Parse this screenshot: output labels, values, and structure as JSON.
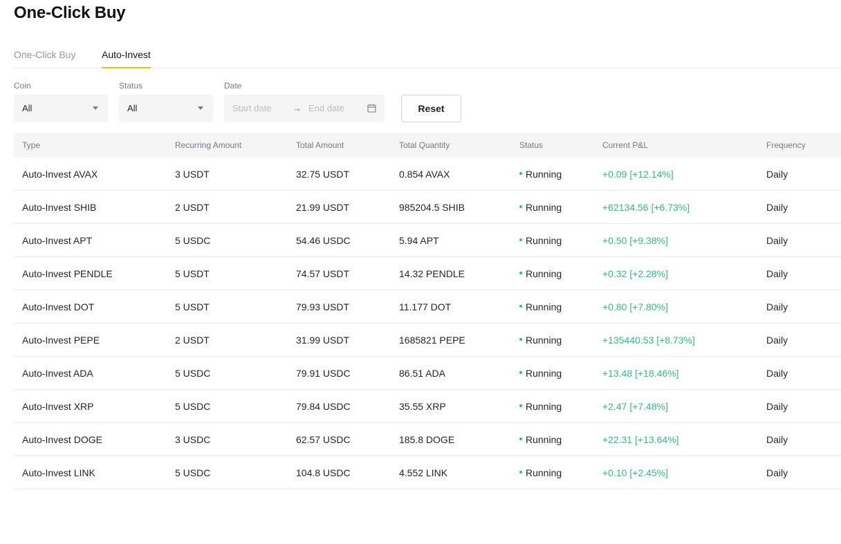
{
  "page": {
    "title": "One-Click Buy"
  },
  "tabs": [
    {
      "label": "One-Click Buy",
      "active": false
    },
    {
      "label": "Auto-Invest",
      "active": true
    }
  ],
  "filters": {
    "coin": {
      "label": "Coin",
      "value": "All"
    },
    "status": {
      "label": "Status",
      "value": "All"
    },
    "date": {
      "label": "Date",
      "start_placeholder": "Start date",
      "end_placeholder": "End date",
      "separator": "→"
    },
    "reset_label": "Reset"
  },
  "colors": {
    "accent": "#f0b90b",
    "positive": "#2ebd85"
  },
  "table": {
    "columns": [
      "Type",
      "Recurring Amount",
      "Total Amount",
      "Total Quantity",
      "Status",
      "Current P&L",
      "Frequency"
    ],
    "rows": [
      {
        "type": "Auto-Invest AVAX",
        "recurring": "3 USDT",
        "total": "32.75 USDT",
        "quantity": "0.854 AVAX",
        "status": "Running",
        "pnl": "+0.09 [+12.14%]",
        "frequency": "Daily"
      },
      {
        "type": "Auto-Invest SHIB",
        "recurring": "2 USDT",
        "total": "21.99 USDT",
        "quantity": "985204.5 SHIB",
        "status": "Running",
        "pnl": "+62134.56 [+6.73%]",
        "frequency": "Daily"
      },
      {
        "type": "Auto-Invest APT",
        "recurring": "5 USDC",
        "total": "54.46 USDC",
        "quantity": "5.94 APT",
        "status": "Running",
        "pnl": "+0.50 [+9.38%]",
        "frequency": "Daily"
      },
      {
        "type": "Auto-Invest PENDLE",
        "recurring": "5 USDT",
        "total": "74.57 USDT",
        "quantity": "14.32 PENDLE",
        "status": "Running",
        "pnl": "+0.32 [+2.28%]",
        "frequency": "Daily"
      },
      {
        "type": "Auto-Invest DOT",
        "recurring": "5 USDT",
        "total": "79.93 USDT",
        "quantity": "11.177 DOT",
        "status": "Running",
        "pnl": "+0.80 [+7.80%]",
        "frequency": "Daily"
      },
      {
        "type": "Auto-Invest PEPE",
        "recurring": "2 USDT",
        "total": "31.99 USDT",
        "quantity": "1685821 PEPE",
        "status": "Running",
        "pnl": "+135440.53 [+8.73%]",
        "frequency": "Daily"
      },
      {
        "type": "Auto-Invest ADA",
        "recurring": "5 USDC",
        "total": "79.91 USDC",
        "quantity": "86.51 ADA",
        "status": "Running",
        "pnl": "+13.48 [+18.46%]",
        "frequency": "Daily"
      },
      {
        "type": "Auto-Invest XRP",
        "recurring": "5 USDC",
        "total": "79.84 USDC",
        "quantity": "35.55 XRP",
        "status": "Running",
        "pnl": "+2.47 [+7.48%]",
        "frequency": "Daily"
      },
      {
        "type": "Auto-Invest DOGE",
        "recurring": "3 USDC",
        "total": "62.57 USDC",
        "quantity": "185.8 DOGE",
        "status": "Running",
        "pnl": "+22.31 [+13.64%]",
        "frequency": "Daily"
      },
      {
        "type": "Auto-Invest LINK",
        "recurring": "5 USDC",
        "total": "104.8 USDC",
        "quantity": "4.552 LINK",
        "status": "Running",
        "pnl": "+0.10 [+2.45%]",
        "frequency": "Daily"
      }
    ]
  }
}
